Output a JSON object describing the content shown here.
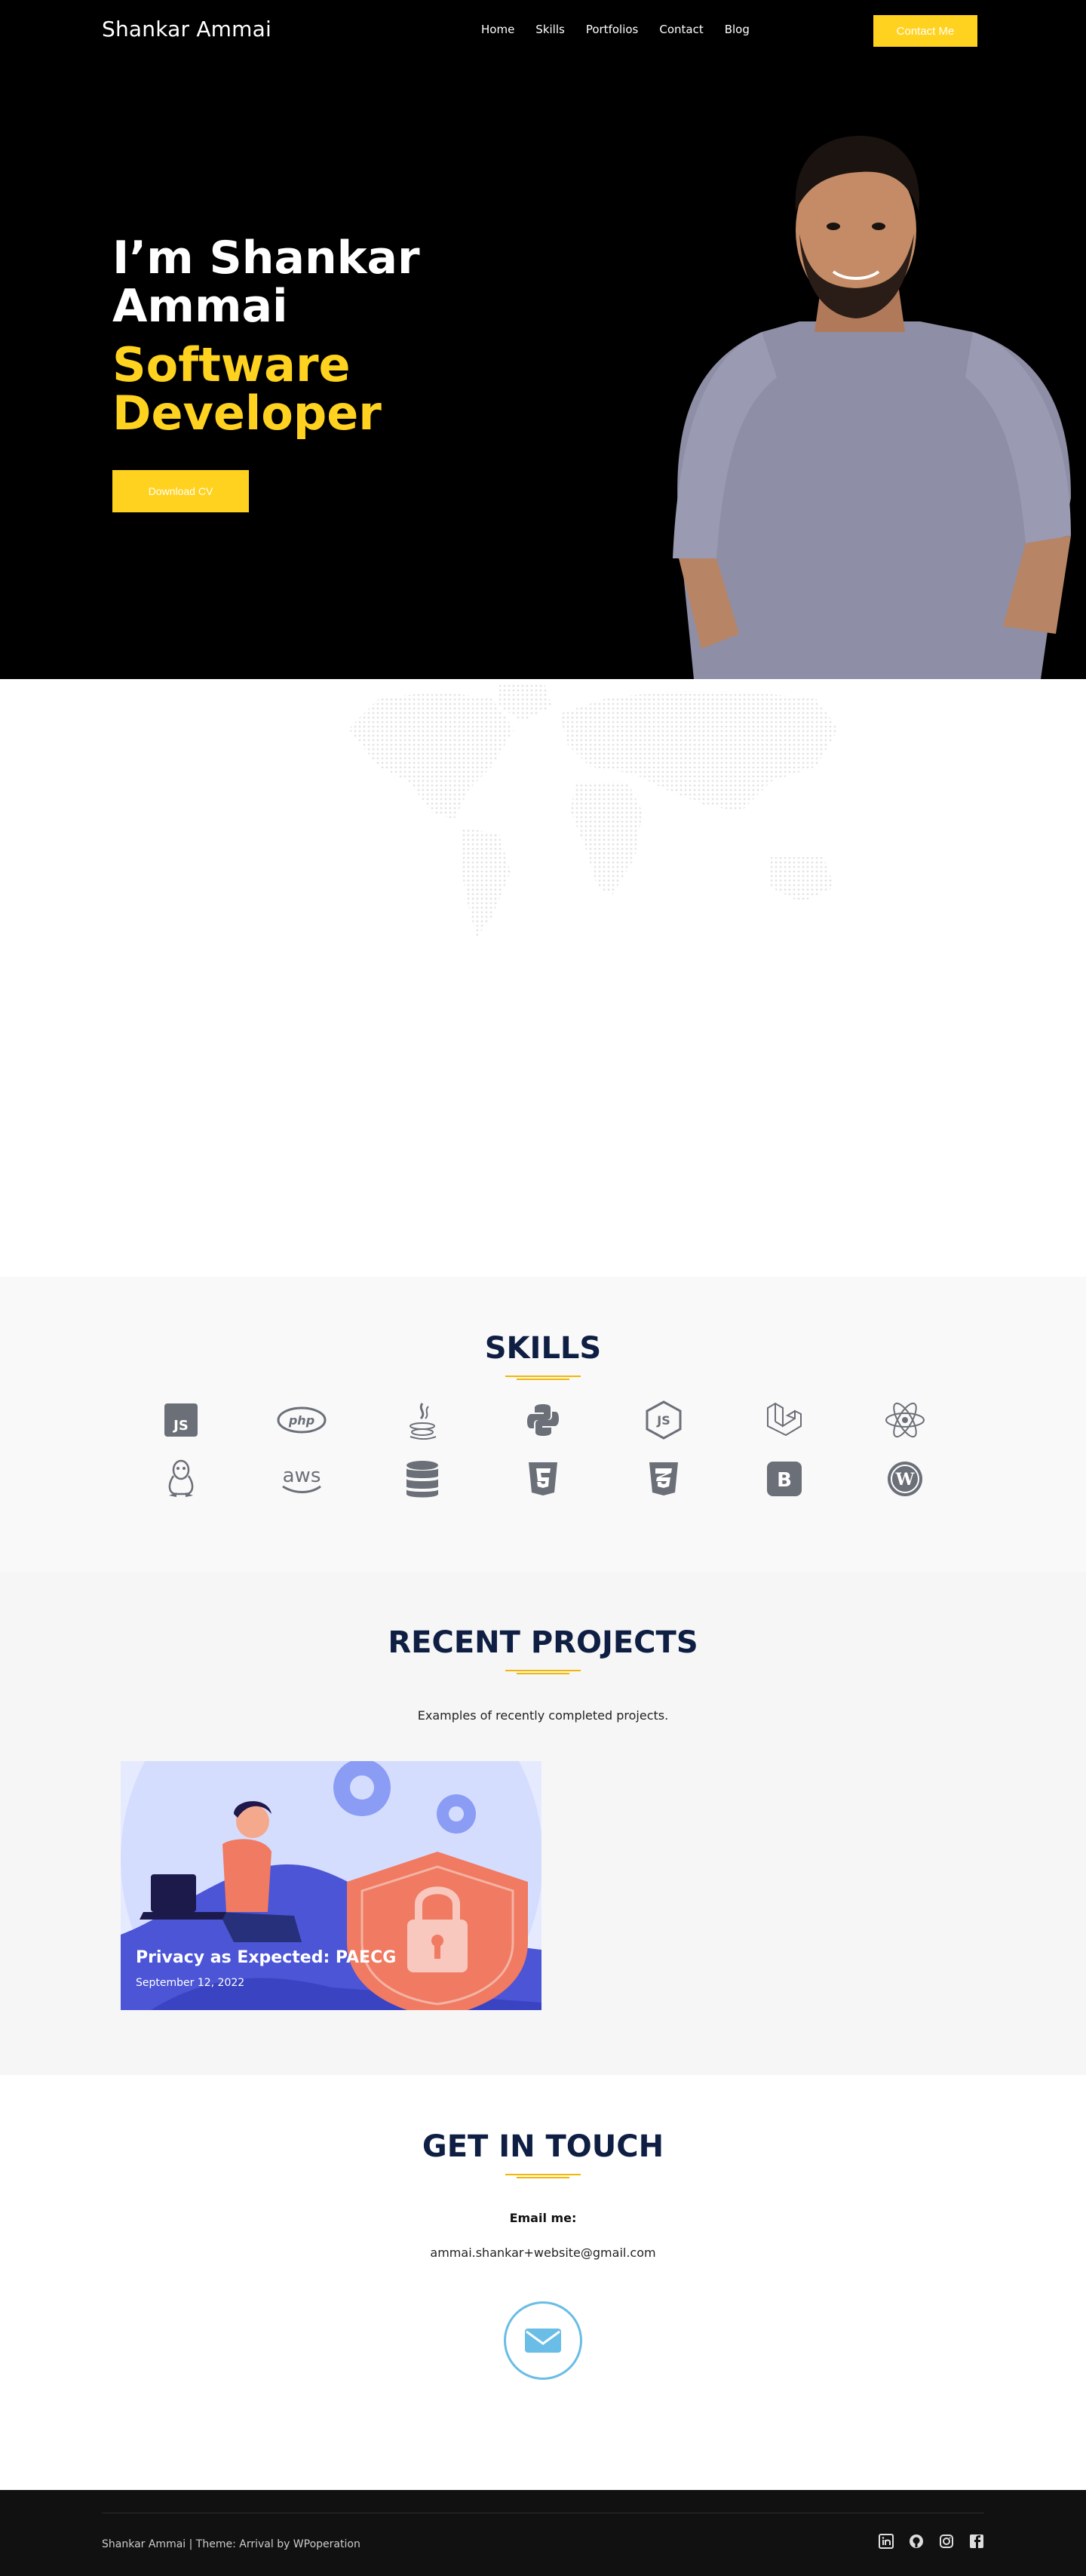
{
  "header": {
    "brand": "Shankar Ammai",
    "nav": [
      "Home",
      "Skills",
      "Portfolios",
      "Contact",
      "Blog"
    ],
    "cta": "Contact Me"
  },
  "hero": {
    "title": "I’m Shankar Ammai",
    "subtitle": "Software Developer",
    "button": "Download CV"
  },
  "skills": {
    "title": "SKILLS",
    "icons_row1": [
      "javascript-icon",
      "php-icon",
      "java-icon",
      "python-icon",
      "nodejs-icon",
      "laravel-icon",
      "react-icon"
    ],
    "icons_row2": [
      "linux-icon",
      "aws-icon",
      "database-icon",
      "html5-icon",
      "css3-icon",
      "bootstrap-icon",
      "wordpress-icon"
    ]
  },
  "projects": {
    "title": "RECENT PROJECTS",
    "description": "Examples of recently completed projects.",
    "cards": [
      {
        "title": "Privacy as Expected: PAECG",
        "date": "September 12, 2022"
      }
    ]
  },
  "contact": {
    "title": "GET IN TOUCH",
    "email_label": "Email me:",
    "email": "ammai.shankar+website@gmail.com"
  },
  "footer": {
    "text": "Shankar Ammai | Theme: Arrival by WPoperation",
    "social": [
      "linkedin-icon",
      "github-icon",
      "instagram-icon",
      "facebook-icon"
    ]
  },
  "colors": {
    "accent": "#ffd21f",
    "navy": "#0f1f44",
    "mail_circle": "#69bde6"
  }
}
